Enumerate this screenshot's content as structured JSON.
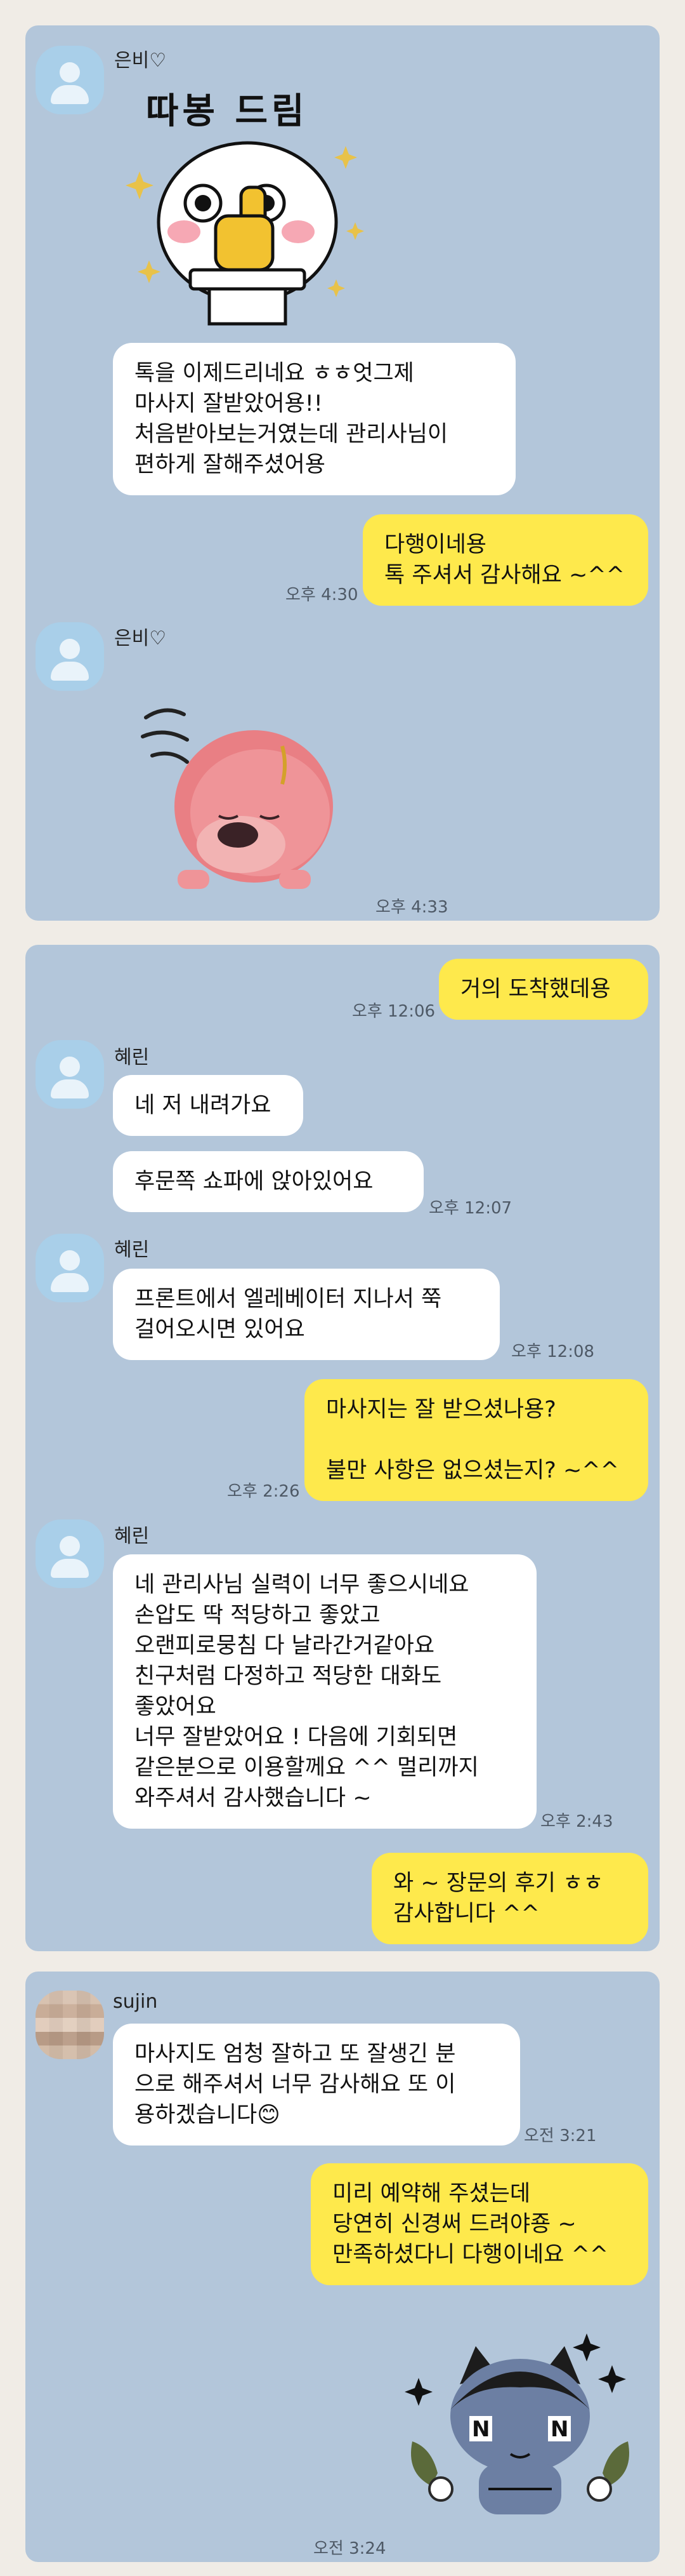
{
  "chats": [
    {
      "sender_name": "은비♡",
      "sticker1_text": "따봉 드림",
      "msg_review": "톡을 이제드리네요 ㅎㅎ엇그제\n마사지 잘받았어용!!\n처음받아보는거였는데 관리사님이\n편하게 잘해주셨어용",
      "reply": "다행이네용\n톡 주셔서 감사해요 ~^^",
      "reply_time": "오후 4:30",
      "sender_name2": "은비♡",
      "sticker2_time": "오후 4:33"
    },
    {
      "first_msg": "거의 도착했데용",
      "first_time": "오후 12:06",
      "sender_name": "혜린",
      "msg1": "네 저 내려가요",
      "msg2": "후문쪽 쇼파에 앉아있어요",
      "msg2_time": "오후 12:07",
      "sender_name2": "혜린",
      "msg3": "프론트에서 엘레베이터 지나서 쭉\n걸어오시면 있어요",
      "msg3_time": "오후 12:08",
      "my_question": "마사지는 잘 받으셨나용?\n\n불만 사항은 없으셨는지? ~^^",
      "my_question_time": "오후 2:26",
      "sender_name3": "혜린",
      "review": "네 관리사님 실력이 너무 좋으시네요\n손압도 딱 적당하고 좋았고\n오랜피로뭉침 다 날라간거같아요\n친구처럼 다정하고 적당한 대화도\n좋았어요\n너무 잘받았어요 ! 다음에 기회되면\n같은분으로 이용할께요 ^^ 멀리까지\n와주셔서 감사했습니다 ~",
      "review_time": "오후 2:43",
      "reply": "와 ~ 장문의 후기 ㅎㅎ\n감사합니다 ^^"
    },
    {
      "sender_name": "sujin",
      "review": "마사지도 엄청 잘하고 또 잘생긴 분\n으로 해주셔서 너무 감사해요 또 이\n용하겠습니다😊",
      "review_time": "오전 3:21",
      "reply": "미리 예약해 주셨는데\n당연히 신경써 드려야죵 ~\n만족하셨다니 다행이네요 ^^",
      "sticker_time": "오전 3:24"
    }
  ],
  "colors": {
    "chat_bg": "#b3c6da",
    "my_bubble": "#fee94c",
    "their_bubble": "#ffffff",
    "page_bg": "#f0ece6"
  }
}
